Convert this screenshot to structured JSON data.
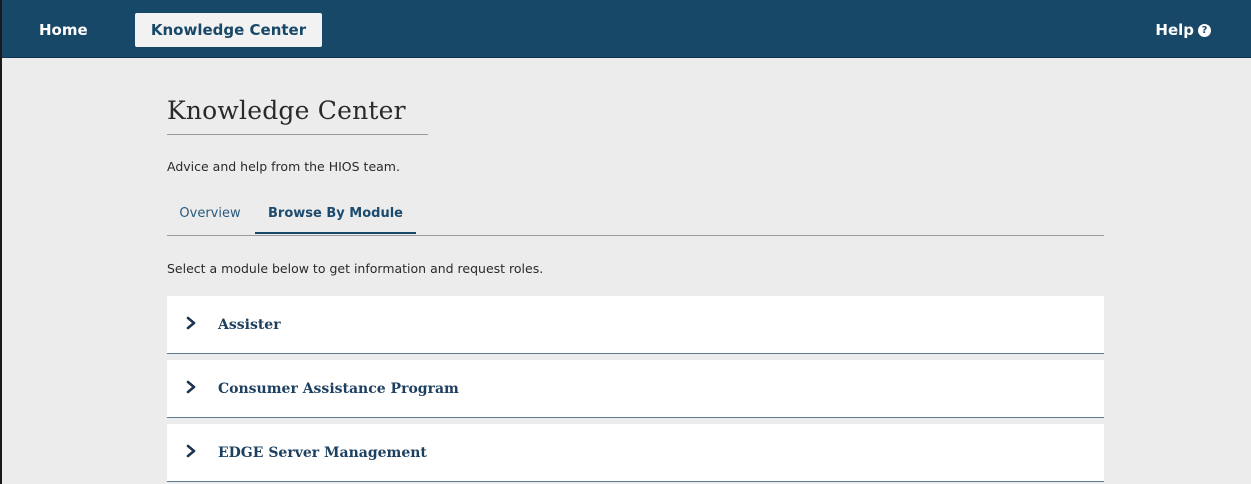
{
  "topnav": {
    "home_label": "Home",
    "knowledge_center_label": "Knowledge Center",
    "help_label": "Help",
    "help_icon": "question-circle-icon"
  },
  "page": {
    "title": "Knowledge Center",
    "subtitle": "Advice and help from the HIOS team.",
    "tabs": [
      {
        "label": "Overview",
        "active": false
      },
      {
        "label": "Browse By Module",
        "active": true
      }
    ],
    "instructions": "Select a module below to get information and request roles."
  },
  "modules": [
    {
      "label": "Assister",
      "expanded": false,
      "icon": "chevron-right-icon"
    },
    {
      "label": "Consumer Assistance Program",
      "expanded": false,
      "icon": "chevron-right-icon"
    },
    {
      "label": "EDGE Server Management",
      "expanded": false,
      "icon": "chevron-right-icon"
    }
  ],
  "colors": {
    "header_bg": "#184868",
    "page_bg": "#ececec",
    "accent": "#1d4060",
    "card_bg": "#ffffff"
  }
}
